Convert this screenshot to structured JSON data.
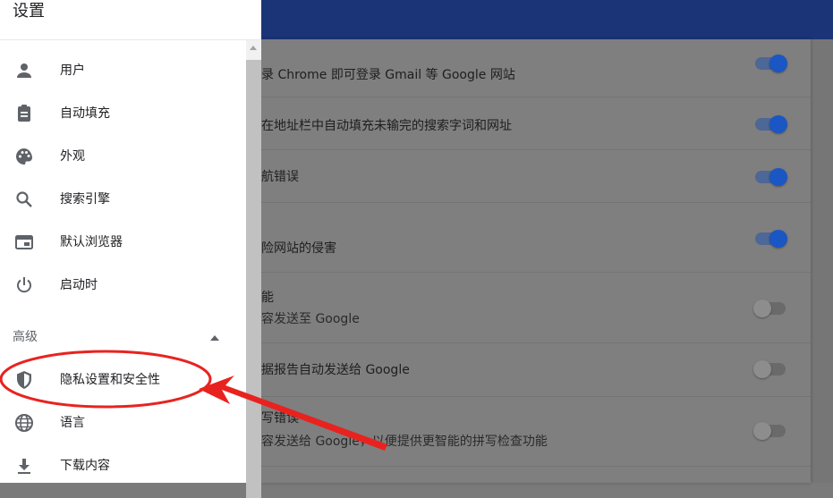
{
  "drawer": {
    "title": "设置",
    "items": [
      {
        "label": "用户",
        "icon": "person-icon"
      },
      {
        "label": "自动填充",
        "icon": "clipboard-icon"
      },
      {
        "label": "外观",
        "icon": "palette-icon"
      },
      {
        "label": "搜索引擎",
        "icon": "search-icon"
      },
      {
        "label": "默认浏览器",
        "icon": "browser-icon"
      },
      {
        "label": "启动时",
        "icon": "power-icon"
      }
    ],
    "advanced_label": "高级",
    "advanced_items": [
      {
        "label": "隐私设置和安全性",
        "icon": "shield-icon",
        "highlighted": true
      },
      {
        "label": "语言",
        "icon": "globe-icon"
      },
      {
        "label": "下载内容",
        "icon": "download-icon"
      }
    ]
  },
  "settings_rows": [
    {
      "line1": "录 Chrome 即可登录 Gmail 等 Google 网站",
      "line2": "",
      "enabled": true
    },
    {
      "line1": "在地址栏中自动填充未输完的搜索字词和网址",
      "line2": "",
      "enabled": true
    },
    {
      "line1": "航错误",
      "line2": "",
      "enabled": true
    },
    {
      "line1": "险网站的侵害",
      "line2": "",
      "enabled": true
    },
    {
      "line1": "能",
      "line2": "容发送至 Google",
      "enabled": false
    },
    {
      "line1": "据报告自动发送给 Google",
      "line2": "",
      "enabled": false
    },
    {
      "line1": "写错误",
      "line2": "容发送给 Google，以便提供更智能的拼写检查功能",
      "enabled": false
    }
  ],
  "colors": {
    "header": "#1b3477",
    "toggle_on": "#1a56c4",
    "annotation": "#e8231f"
  }
}
